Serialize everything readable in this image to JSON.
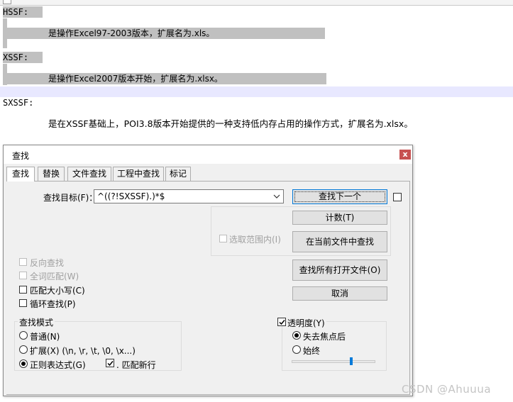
{
  "editor": {
    "lines": {
      "l1": "HSSF:",
      "l2": "是操作Excel97-2003版本，扩展名为.xls。",
      "l3": "XSSF:",
      "l4": "是操作Excel2007版本开始，扩展名为.xlsx。",
      "l5": "SXSSF:",
      "l6": "是在XSSF基础上，POI3.8版本开始提供的一种支持低内存占用的操作方式，扩展名为.xlsx。"
    },
    "selection_color": "#c0c0c0",
    "current_line_color": "#e8e8ff"
  },
  "dialog": {
    "title": "查找",
    "close_label": "x",
    "tabs": [
      "查找",
      "替换",
      "文件查找",
      "工程中查找",
      "标记"
    ],
    "active_tab": "查找",
    "find_target_label": "查找目标(F)：",
    "find_target_value": "^((?!SXSSF).)*$",
    "buttons": {
      "find_next": "查找下一个",
      "count": "计数(T)",
      "find_in_current": "在当前文件中查找",
      "find_all_open": "查找所有打开文件(O)",
      "cancel": "取消"
    },
    "in_selection_label": "选取范围内(I)",
    "options": {
      "reverse": "反向查找",
      "whole_word": "全词匹配(W)",
      "match_case": "匹配大小写(C)",
      "wrap": "循环查找(P)"
    },
    "search_mode": {
      "title": "查找模式",
      "normal": "普通(N)",
      "extended": "扩展(X) (\\n, \\r, \\t, \\0, \\x...)",
      "regex": "正则表达式(G)",
      "dot_newline": ". 匹配新行",
      "selected": "regex",
      "dot_newline_checked": true
    },
    "transparency": {
      "title": "透明度(Y)",
      "checked": true,
      "on_lose_focus": "失去焦点后",
      "always": "始终",
      "selected": "on_lose_focus",
      "slider_level": 0.72
    },
    "accent_color": "#0078d7",
    "close_color": "#c75050"
  },
  "watermark": "CSDN @Ahuuua"
}
